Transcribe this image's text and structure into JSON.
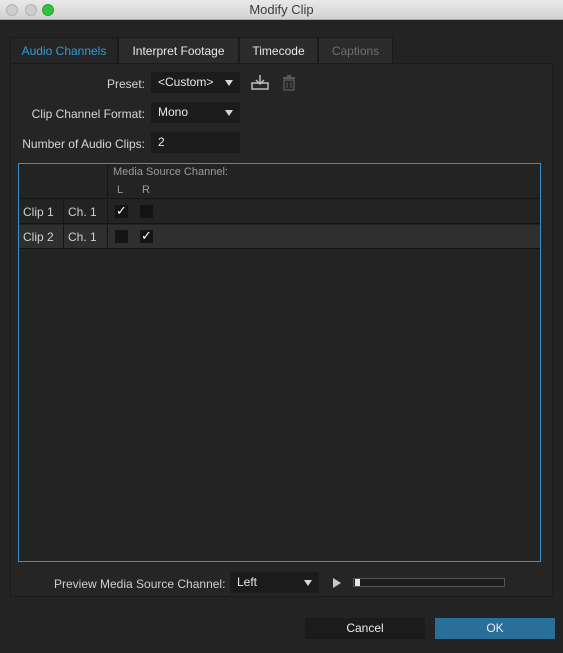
{
  "window": {
    "title": "Modify Clip"
  },
  "tabs": [
    {
      "label": "Audio Channels",
      "state": "active"
    },
    {
      "label": "Interpret Footage",
      "state": "normal"
    },
    {
      "label": "Timecode",
      "state": "normal"
    },
    {
      "label": "Captions",
      "state": "disabled"
    }
  ],
  "form": {
    "preset_label": "Preset:",
    "preset_value": "<Custom>",
    "clip_format_label": "Clip Channel Format:",
    "clip_format_value": "Mono",
    "num_clips_label": "Number of Audio Clips:",
    "num_clips_value": "2"
  },
  "icons": {
    "save_preset": "save-preset-icon",
    "delete_preset": "trash-icon"
  },
  "table": {
    "header_media": "Media Source Channel:",
    "col_l": "L",
    "col_r": "R",
    "rows": [
      {
        "clip": "Clip 1",
        "ch": "Ch. 1",
        "L": true,
        "R": false
      },
      {
        "clip": "Clip 2",
        "ch": "Ch. 1",
        "L": false,
        "R": true
      }
    ]
  },
  "preview": {
    "label": "Preview Media Source Channel:",
    "value": "Left",
    "progress": 0
  },
  "buttons": {
    "cancel": "Cancel",
    "ok": "OK"
  },
  "colors": {
    "accent": "#2d9ed8",
    "ok_button": "#2a6f9a",
    "background": "#232323"
  }
}
